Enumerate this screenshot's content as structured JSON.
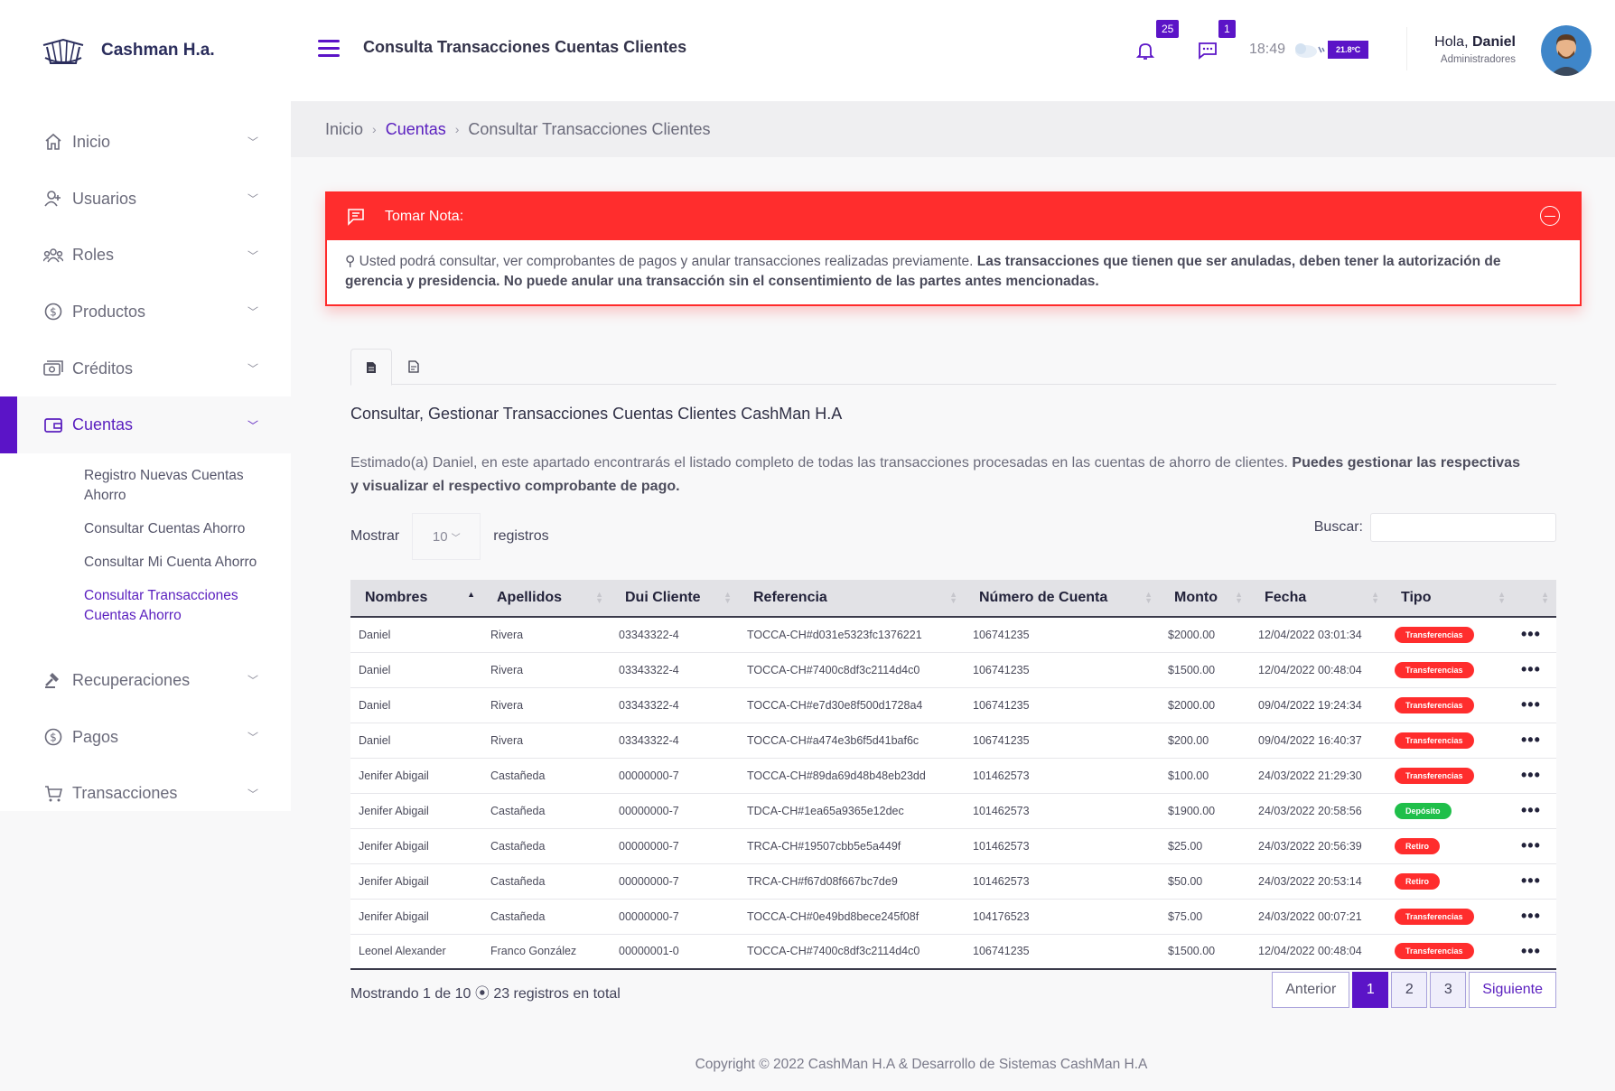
{
  "brand": {
    "name": "Cashman H.a."
  },
  "sidebar": {
    "items": [
      {
        "label": "Inicio",
        "icon": "home-icon"
      },
      {
        "label": "Usuarios",
        "icon": "user-plus-icon"
      },
      {
        "label": "Roles",
        "icon": "users-group-icon"
      },
      {
        "label": "Productos",
        "icon": "dollar-circle-icon"
      },
      {
        "label": "Créditos",
        "icon": "money-icon"
      },
      {
        "label": "Cuentas",
        "icon": "wallet-icon",
        "active": true
      },
      {
        "label": "Recuperaciones",
        "icon": "gavel-icon"
      },
      {
        "label": "Pagos",
        "icon": "dollar-circle-icon"
      },
      {
        "label": "Transacciones",
        "icon": "cart-icon"
      }
    ],
    "subitems": [
      "Registro Nuevas Cuentas Ahorro",
      "Consultar Cuentas Ahorro",
      "Consultar Mi Cuenta Ahorro",
      "Consultar Transacciones Cuentas Ahorro"
    ]
  },
  "header": {
    "title": "Consulta Transacciones Cuentas Clientes",
    "notifications": "25",
    "messages": "1",
    "time": "18:49",
    "temperature": "21.8ºC",
    "greeting": "Hola,",
    "user": "Daniel",
    "role": "Administradores"
  },
  "breadcrumb": {
    "home": "Inicio",
    "section": "Cuentas",
    "current": "Consultar Transacciones Clientes"
  },
  "alert": {
    "title": "Tomar Nota:",
    "text": "Usted podrá consultar, ver comprobantes de pagos y anular transacciones realizadas previamente.",
    "bold": "Las transacciones que tienen que ser anuladas, deben tener la autorización de gerencia y presidencia. No puede anular una transacción sin el consentimiento de las partes antes mencionadas."
  },
  "main": {
    "title": "Consultar, Gestionar Transacciones Cuentas Clientes CashMan H.A",
    "desc": "Estimado(a) Daniel, en este apartado encontrarás el listado completo de todas las transacciones procesadas en las cuentas de ahorro de clientes.",
    "desc_bold": "Puedes gestionar las respectivas y visualizar el respectivo comprobante de pago.",
    "show_label": "Mostrar",
    "show_value": "10",
    "records_label": "registros",
    "search_label": "Buscar:"
  },
  "table": {
    "headers": [
      "Nombres",
      "Apellidos",
      "Dui Cliente",
      "Referencia",
      "Número de Cuenta",
      "Monto",
      "Fecha",
      "Tipo"
    ],
    "rows": [
      [
        "Daniel",
        "Rivera",
        "03343322-4",
        "TOCCA-CH#d031e5323fc1376221",
        "106741235",
        "$2000.00",
        "12/04/2022 03:01:34",
        "Transferencias"
      ],
      [
        "Daniel",
        "Rivera",
        "03343322-4",
        "TOCCA-CH#7400c8df3c2114d4c0",
        "106741235",
        "$1500.00",
        "12/04/2022 00:48:04",
        "Transferencias"
      ],
      [
        "Daniel",
        "Rivera",
        "03343322-4",
        "TOCCA-CH#e7d30e8f500d1728a4",
        "106741235",
        "$2000.00",
        "09/04/2022 19:24:34",
        "Transferencias"
      ],
      [
        "Daniel",
        "Rivera",
        "03343322-4",
        "TOCCA-CH#a474e3b6f5d41baf6c",
        "106741235",
        "$200.00",
        "09/04/2022 16:40:37",
        "Transferencias"
      ],
      [
        "Jenifer Abigail",
        "Castañeda",
        "00000000-7",
        "TOCCA-CH#89da69d48b48eb23dd",
        "101462573",
        "$100.00",
        "24/03/2022 21:29:30",
        "Transferencias"
      ],
      [
        "Jenifer Abigail",
        "Castañeda",
        "00000000-7",
        "TDCA-CH#1ea65a9365e12dec",
        "101462573",
        "$1900.00",
        "24/03/2022 20:58:56",
        "Depósito"
      ],
      [
        "Jenifer Abigail",
        "Castañeda",
        "00000000-7",
        "TRCA-CH#19507cbb5e5a449f",
        "101462573",
        "$25.00",
        "24/03/2022 20:56:39",
        "Retiro"
      ],
      [
        "Jenifer Abigail",
        "Castañeda",
        "00000000-7",
        "TRCA-CH#f67d08f667bc7de9",
        "101462573",
        "$50.00",
        "24/03/2022 20:53:14",
        "Retiro"
      ],
      [
        "Jenifer Abigail",
        "Castañeda",
        "00000000-7",
        "TOCCA-CH#0e49bd8bece245f08f",
        "104176523",
        "$75.00",
        "24/03/2022 00:07:21",
        "Transferencias"
      ],
      [
        "Leonel Alexander",
        "Franco González",
        "00000001-0",
        "TOCCA-CH#7400c8df3c2114d4c0",
        "106741235",
        "$1500.00",
        "12/04/2022 00:48:04",
        "Transferencias"
      ]
    ],
    "type_colors": {
      "Transferencias": "#ff2d2d",
      "Depósito": "#1fbf4a",
      "Retiro": "#ff2d2d"
    }
  },
  "pagination": {
    "info": "Mostrando 1 de 10 ⦿ 23 registros en total",
    "prev": "Anterior",
    "pages": [
      "1",
      "2",
      "3"
    ],
    "next": "Siguiente"
  },
  "footer": {
    "copyright": "Copyright © 2022 CashMan H.A & Desarrollo de Sistemas CashMan H.A"
  },
  "colors": {
    "accent": "#5b14c7",
    "alert": "#ff2d2d"
  }
}
